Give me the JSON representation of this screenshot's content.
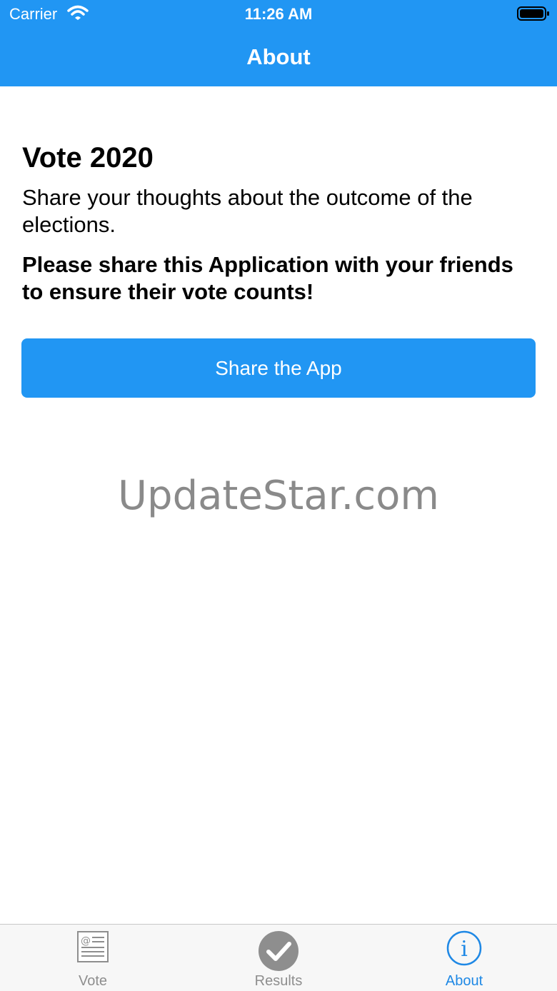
{
  "status_bar": {
    "carrier": "Carrier",
    "time": "11:26 AM"
  },
  "nav": {
    "title": "About"
  },
  "content": {
    "title": "Vote 2020",
    "description": "Share your thoughts about the outcome of the elections.",
    "cta": "Please share this Application with your friends to ensure their vote counts!",
    "share_button": "Share the App"
  },
  "watermark": "UpdateStar.com",
  "tabs": [
    {
      "label": "Vote",
      "icon": "ballot-document-icon",
      "active": false
    },
    {
      "label": "Results",
      "icon": "checkmark-circle-icon",
      "active": false
    },
    {
      "label": "About",
      "icon": "info-circle-icon",
      "active": true
    }
  ],
  "colors": {
    "accent": "#2196f3",
    "tab_active": "#1e88e5",
    "tab_inactive": "#8e8e8e"
  }
}
